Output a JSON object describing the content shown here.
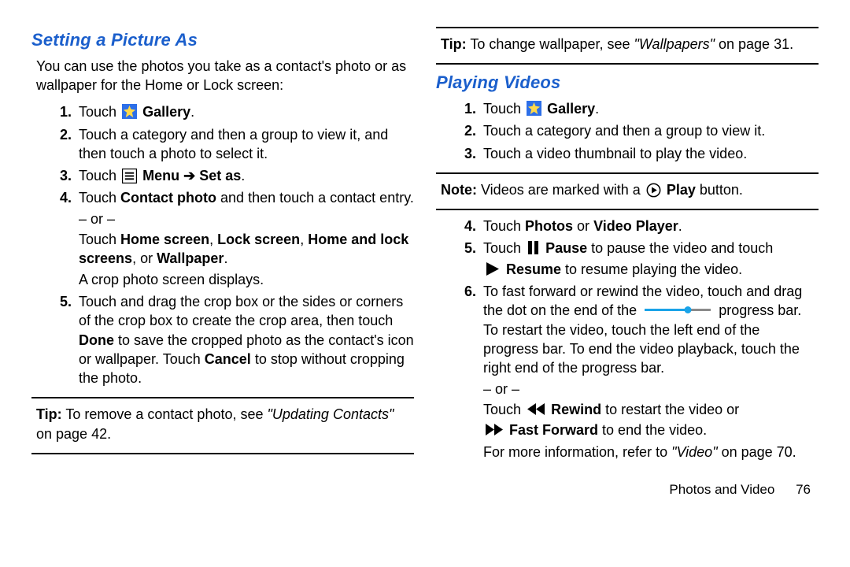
{
  "left": {
    "heading": "Setting a Picture As",
    "intro": "You can use the photos you take as a contact's photo or as wallpaper for the Home or Lock screen:",
    "s1_a": "Touch",
    "s1_gallery": "Gallery",
    "s1_c": ".",
    "s2": "Touch a category and then a group to view it, and then touch a photo to select it.",
    "s3_a": "Touch",
    "s3_menu": "Menu",
    "s3_arrow": "➔",
    "s3_setas": "Set as",
    "s3_c": ".",
    "s4_a": "Touch ",
    "s4_cp": "Contact photo",
    "s4_b": " and then touch a contact entry.",
    "s4_or": "– or –",
    "s4_c": "Touch ",
    "s4_hs": "Home screen",
    "s4_comma1": ", ",
    "s4_ls": "Lock screen",
    "s4_comma2": ", ",
    "s4_hls": "Home and lock screens",
    "s4_or2": ", or ",
    "s4_wp": "Wallpaper",
    "s4_d": ".",
    "s4_e": "A crop photo screen displays.",
    "s5_a": "Touch and drag the crop box or the sides or corners of the crop box to create the crop area, then touch ",
    "s5_done": "Done",
    "s5_b": " to save the cropped photo as the contact's icon or wallpaper. Touch ",
    "s5_cancel": "Cancel",
    "s5_c": " to stop without cropping the photo.",
    "tip_label": "Tip:",
    "tip_a": " To remove a contact photo, see ",
    "tip_ref": "\"Updating Contacts\"",
    "tip_b": " on page 42."
  },
  "right": {
    "tip_label": "Tip:",
    "tip_a": " To change wallpaper, see ",
    "tip_ref": "\"Wallpapers\"",
    "tip_b": " on page 31.",
    "heading": "Playing Videos",
    "s1_a": "Touch",
    "s1_gallery": "Gallery",
    "s1_c": ".",
    "s2": "Touch a category and then a group to view it.",
    "s3": "Touch a video thumbnail to play the video.",
    "note_label": "Note:",
    "note_a": " Videos are marked with a",
    "note_play": "Play",
    "note_b": " button.",
    "s4_a": "Touch ",
    "s4_photos": "Photos",
    "s4_or": " or ",
    "s4_vp": "Video Player",
    "s4_b": ".",
    "s5_a": "Touch",
    "s5_pause": "Pause",
    "s5_b": " to pause the video and touch",
    "s5_resume": "Resume",
    "s5_c": " to resume playing the video.",
    "s6_a": "To fast forward or rewind the video, touch and drag the dot on the end of the",
    "s6_b": "progress bar. To restart the video, touch the left end of the progress bar. To end the video playback, touch the right end of the progress bar.",
    "s6_or": "– or –",
    "s6_c": "Touch",
    "s6_rew": "Rewind",
    "s6_d": " to restart the video or",
    "s6_ff": "Fast Forward",
    "s6_e": " to end the video.",
    "more_a": "For more information, refer to ",
    "more_ref": "\"Video\"",
    "more_b": " on page 70.",
    "footer_section": "Photos and Video",
    "footer_page": "76"
  }
}
